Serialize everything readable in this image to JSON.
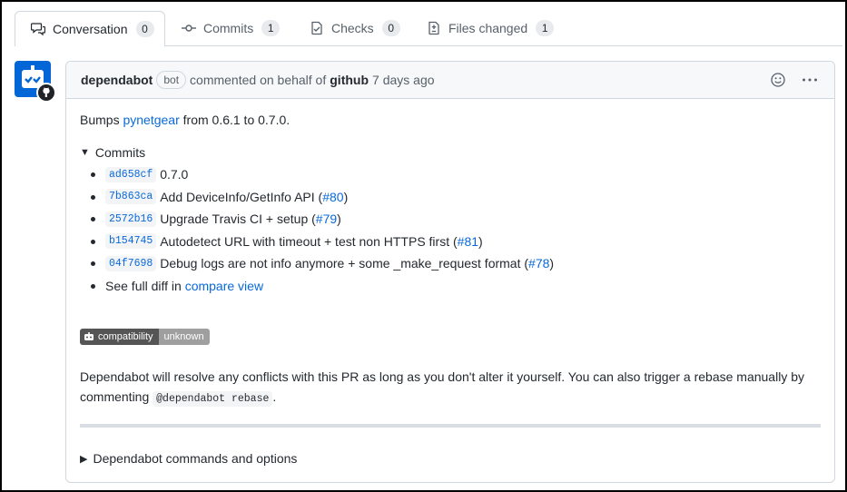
{
  "tabs": [
    {
      "label": "Conversation",
      "count": "0"
    },
    {
      "label": "Commits",
      "count": "1"
    },
    {
      "label": "Checks",
      "count": "0"
    },
    {
      "label": "Files changed",
      "count": "1"
    }
  ],
  "comment": {
    "author": "dependabot",
    "bot_label": "bot",
    "action": "commented on behalf of",
    "on_behalf": "github",
    "time": "7 days ago",
    "bumps_prefix": "Bumps",
    "package": "pynetgear",
    "bumps_suffix": "from 0.6.1 to 0.7.0.",
    "commits_summary": "Commits",
    "commits": [
      {
        "sha": "ad658cf",
        "message": "0.7.0",
        "pr": "",
        "pr_close": ""
      },
      {
        "sha": "7b863ca",
        "message": "Add DeviceInfo/GetInfo API (",
        "pr": "#80",
        "pr_close": ")"
      },
      {
        "sha": "2572b16",
        "message": "Upgrade Travis CI + setup (",
        "pr": "#79",
        "pr_close": ")"
      },
      {
        "sha": "b154745",
        "message": "Autodetect URL with timeout + test non HTTPS first (",
        "pr": "#81",
        "pr_close": ")"
      },
      {
        "sha": "04f7698",
        "message": "Debug logs are not info anymore + some _make_request format (",
        "pr": "#78",
        "pr_close": ")"
      }
    ],
    "full_diff_prefix": "See full diff in",
    "compare_link": "compare view",
    "badge_left": "compatibility",
    "badge_right": "unknown",
    "resolve_text_1": "Dependabot will resolve any conflicts with this PR as long as you don't alter it yourself. You can also trigger a rebase manually by",
    "resolve_text_2": "commenting",
    "rebase_cmd": "@dependabot rebase",
    "resolve_end": ".",
    "commands_summary": "Dependabot commands and options"
  },
  "colors": {
    "accent": "#0969da",
    "avatar": "#0366d6",
    "border": "#d0d7de",
    "header_bg": "#f6f8fa"
  },
  "icons": {
    "tabs": [
      "conversation-icon",
      "commit-icon",
      "checklist-icon",
      "file-diff-icon"
    ],
    "header": [
      "smiley-icon",
      "kebab-horizontal-icon"
    ]
  }
}
